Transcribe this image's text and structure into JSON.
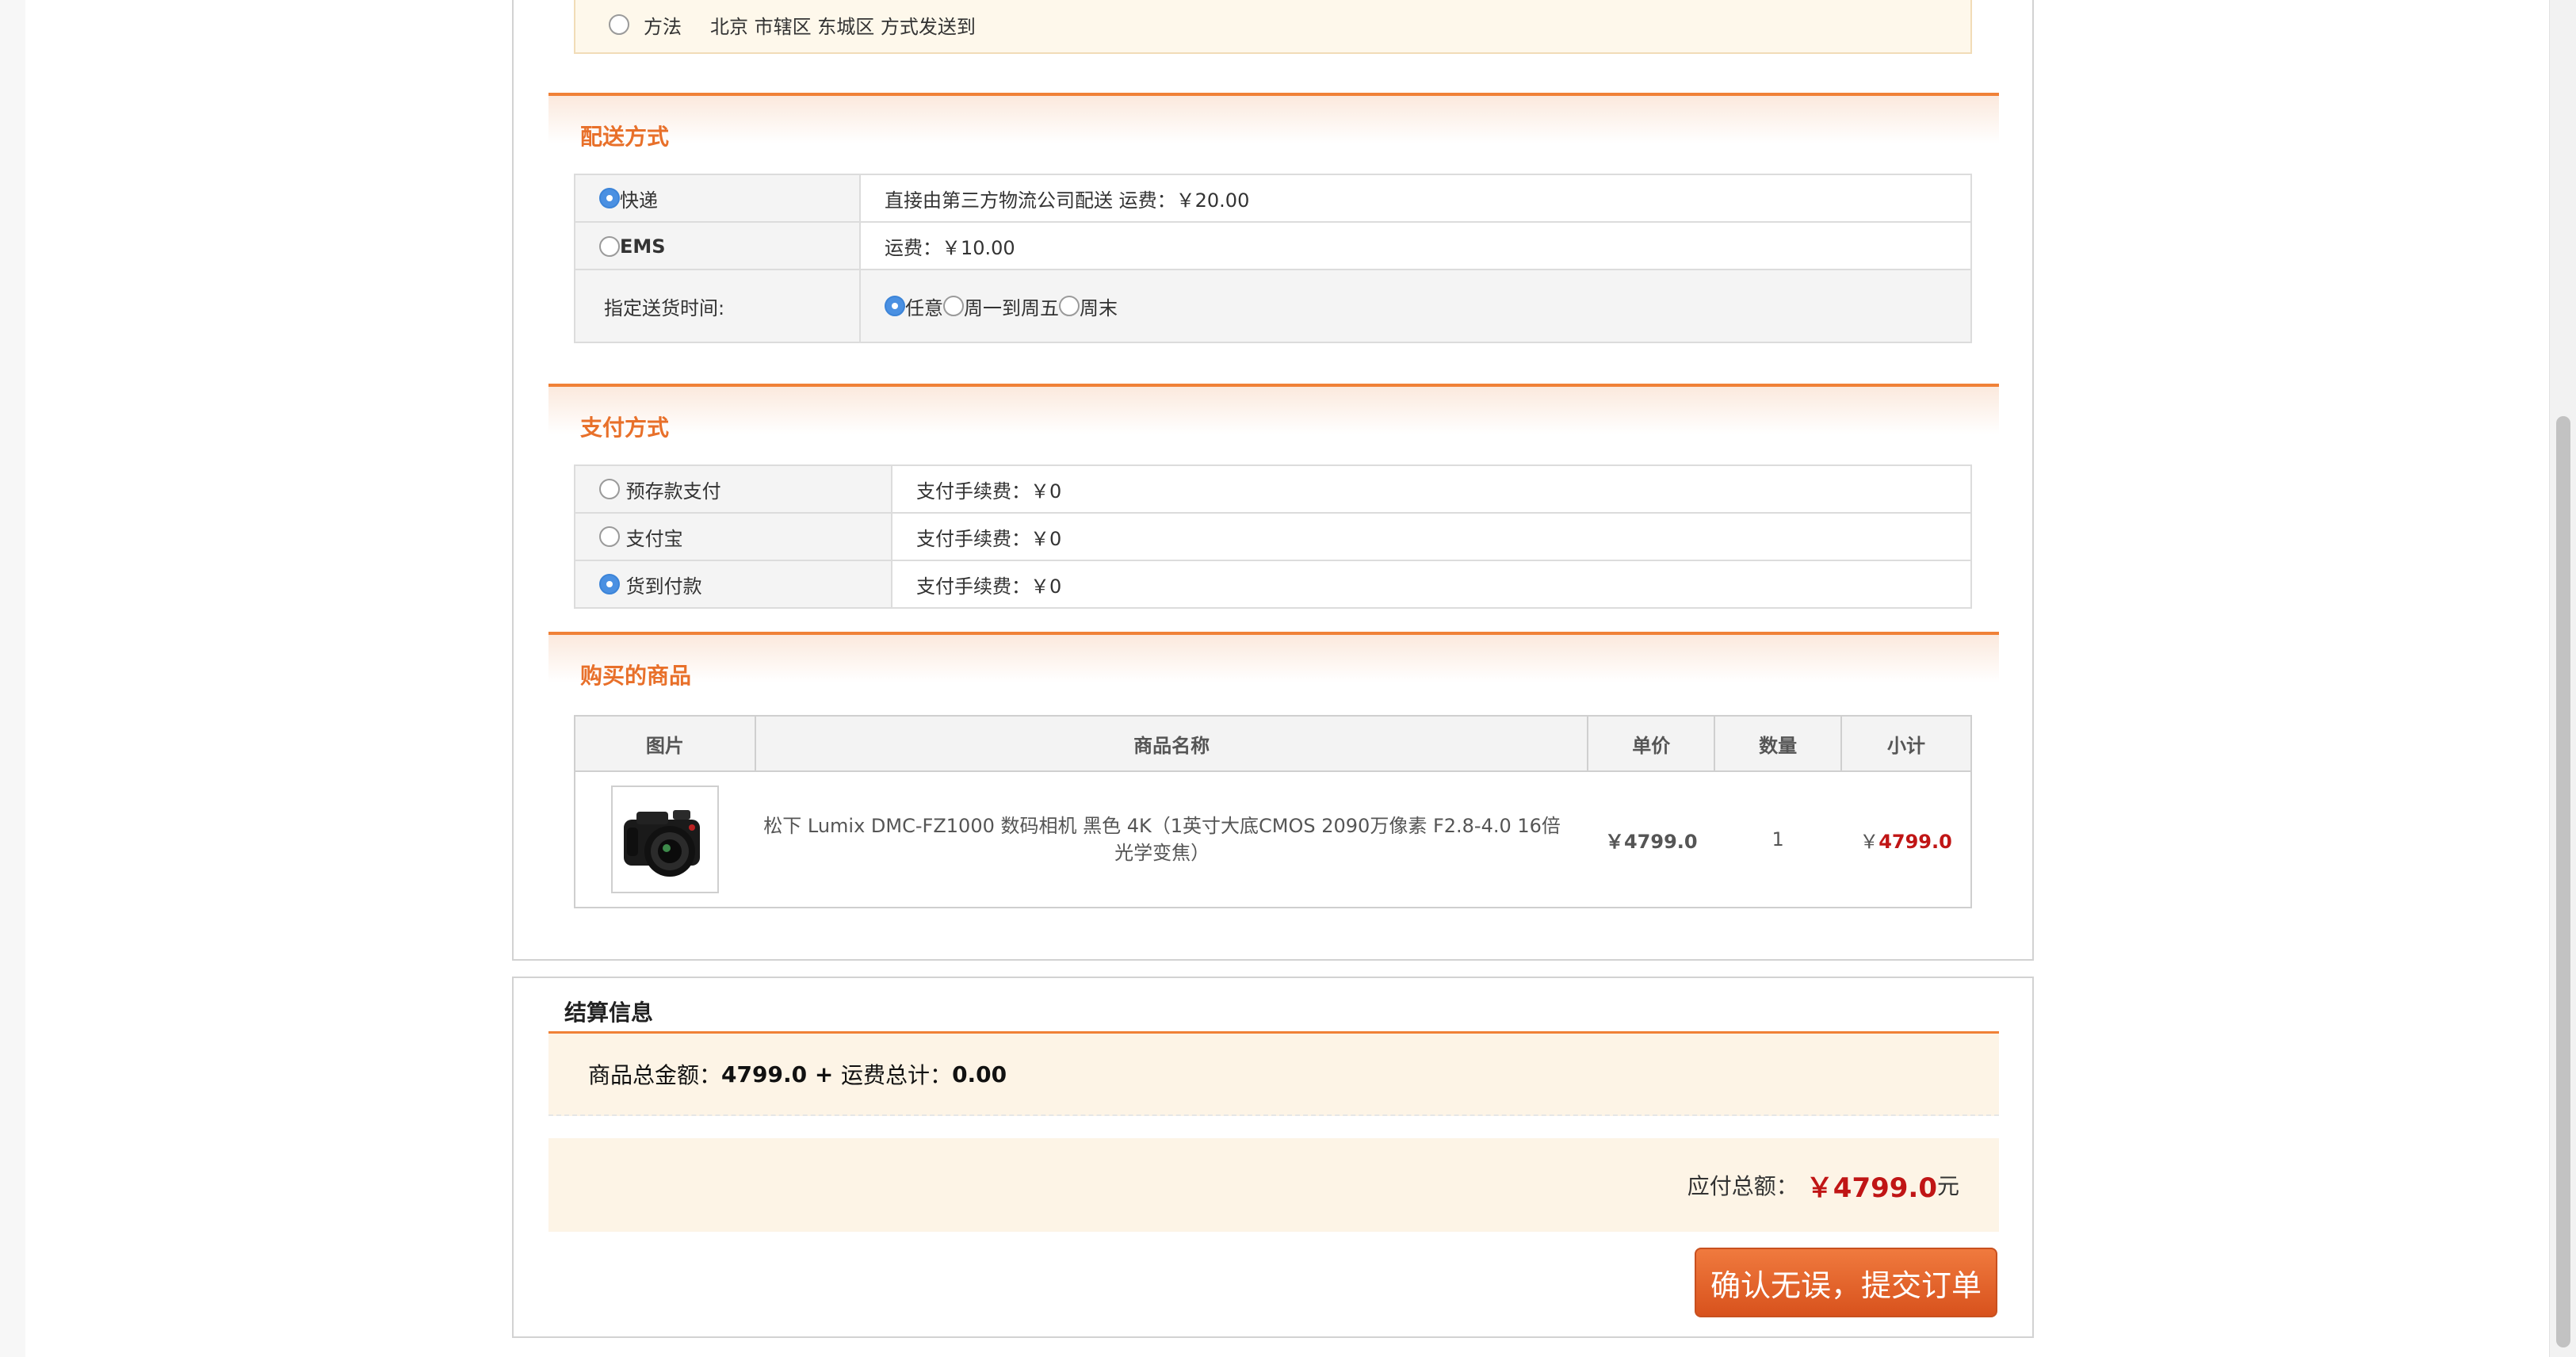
{
  "address": {
    "label": "方法",
    "text": "北京 市辖区 东城区 方式发送到"
  },
  "shipping": {
    "title": "配送方式",
    "options": [
      {
        "name": "快递",
        "desc": "直接由第三方物流公司配送 运费：￥20.00",
        "selected": true
      },
      {
        "name": "EMS",
        "desc": "运费：￥10.00",
        "selected": false
      }
    ],
    "time_label": "指定送货时间:",
    "time_options": [
      {
        "name": "任意",
        "selected": true
      },
      {
        "name": "周一到周五",
        "selected": false
      },
      {
        "name": "周末",
        "selected": false
      }
    ]
  },
  "payment": {
    "title": "支付方式",
    "options": [
      {
        "name": "预存款支付",
        "fee": "支付手续费：￥0",
        "selected": false
      },
      {
        "name": "支付宝",
        "fee": "支付手续费：￥0",
        "selected": false
      },
      {
        "name": "货到付款",
        "fee": "支付手续费：￥0",
        "selected": true
      }
    ]
  },
  "goods": {
    "title": "购买的商品",
    "headers": [
      "图片",
      "商品名称",
      "单价",
      "数量",
      "小计"
    ],
    "items": [
      {
        "name": "松下 Lumix DMC-FZ1000 数码相机 黑色 4K（1英寸大底CMOS 2090万像素 F2.8-4.0 16倍光学变焦）",
        "price": "￥4799.0",
        "qty": "1",
        "currency": "￥",
        "subtotal": "4799.0"
      }
    ]
  },
  "settlement": {
    "title": "结算信息",
    "goods_total_label": "商品总金额：",
    "goods_total": "4799.0",
    "plus": " + ",
    "shipping_total_label": "运费总计：",
    "shipping_total": "0.00",
    "payable_label": "应付总额：",
    "payable_amount": "￥4799.0",
    "payable_unit": "元",
    "submit_label": "确认无误，提交订单"
  },
  "colors": {
    "accent": "#f08137",
    "title": "#e8702a",
    "price": "#c01515",
    "link": "#1e5fc0"
  }
}
